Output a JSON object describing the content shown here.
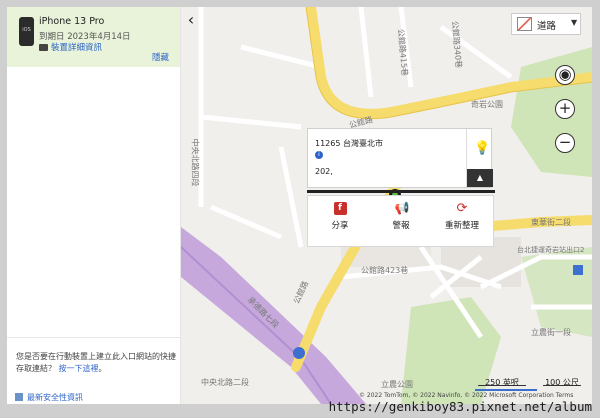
{
  "device": {
    "name": "iPhone 13 Pro",
    "expiry": "到期日 2023年4月14日",
    "details_link": "裝置詳細資訊",
    "hide_label": "隱藏",
    "os_label": "iOS"
  },
  "left_bottom": {
    "question": "您是否要在行動裝置上建立此入口網站的快捷存取連結？",
    "learn_more": "按一下這裡",
    "security_link": "最新安全性資訊"
  },
  "map": {
    "map_type_label": "道路",
    "address": "11265 台灣臺北市",
    "number": "202,",
    "share_label": "分享",
    "report_label": "警報",
    "refresh_label": "重新整理",
    "scale_left": "250 英呎",
    "scale_right": "100 公尺",
    "copyright": "© 2022 TomTom, © 2022 Navinfo, © 2022 Microsoft Corporation  Terms",
    "road_labels": {
      "gongguan": "公館路",
      "donghua": "東華街二段",
      "gongguan2": "公館路",
      "chengde": "承德路七段",
      "lane423": "公館路423巷",
      "qiyan": "奇岩公園",
      "lane415": "公館路415巷",
      "lane340": "公館路340巷",
      "zhongyang": "中央北路四段",
      "metro": "台北捷運奇岩站出口2",
      "tangtang": "立農公園",
      "lihang": "立農街一段",
      "zhongyang2": "中央北路二段"
    }
  },
  "watermark": "https://genkiboy83.pixnet.net/album",
  "colors": {
    "accent_green": "#e8f3d9",
    "link_blue": "#2d63c8",
    "road_yellow": "#f6dc6c",
    "rail_purple": "#c6a8dc"
  }
}
